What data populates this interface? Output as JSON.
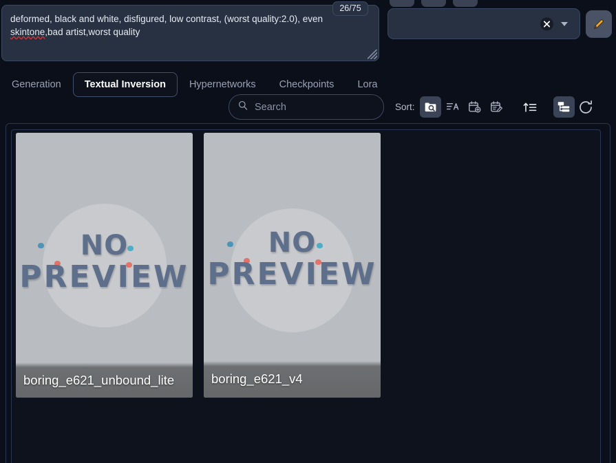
{
  "prompt": {
    "name": "negative-prompt",
    "text_before": "deformed, black and white, disfigured, low contrast, (worst quality:2.0), even ",
    "misspelled": "skintone",
    "text_after": ",bad artist,worst quality",
    "token_counter": "26/75"
  },
  "top_controls": {
    "combo_value": "",
    "combo_clear_label": "×",
    "pencil_title": "edit"
  },
  "tabs": [
    {
      "label": "Generation",
      "active": false
    },
    {
      "label": "Textual Inversion",
      "active": true
    },
    {
      "label": "Hypernetworks",
      "active": false
    },
    {
      "label": "Checkpoints",
      "active": false
    },
    {
      "label": "Lora",
      "active": false
    }
  ],
  "toolbar": {
    "search_placeholder": "Search",
    "search_value": "",
    "sort_label": "Sort:",
    "sort_buttons": [
      {
        "name": "sort-by-path-icon",
        "title": "Path",
        "active": true
      },
      {
        "name": "sort-by-name-icon",
        "title": "Name",
        "active": false
      },
      {
        "name": "sort-by-date-created-icon",
        "title": "Date Created",
        "active": false
      },
      {
        "name": "sort-by-date-modified-icon",
        "title": "Date Modified",
        "active": false
      }
    ],
    "order_button": {
      "name": "sort-ascending-icon",
      "title": "Ascending",
      "active": false
    },
    "tree_button": {
      "name": "tree-view-icon",
      "title": "Tree View",
      "active": true
    },
    "refresh_button": {
      "name": "refresh-icon",
      "title": "Refresh",
      "active": false
    }
  },
  "cards": [
    {
      "name": "boring_e621_unbound_lite",
      "preview_line1": "NO",
      "preview_line2": "PREVIEW"
    },
    {
      "name": "boring_e621_v4",
      "preview_line1": "NO",
      "preview_line2": "PREVIEW"
    }
  ],
  "colors": {
    "background": "#0b0f19",
    "panel": "#0d121d",
    "field": "#273142",
    "border": "#3b4a63",
    "accent_text": "#ffffff",
    "muted_text": "#97a2b5",
    "pencil_accent": "#f5a623",
    "spell_error": "#e03131"
  }
}
